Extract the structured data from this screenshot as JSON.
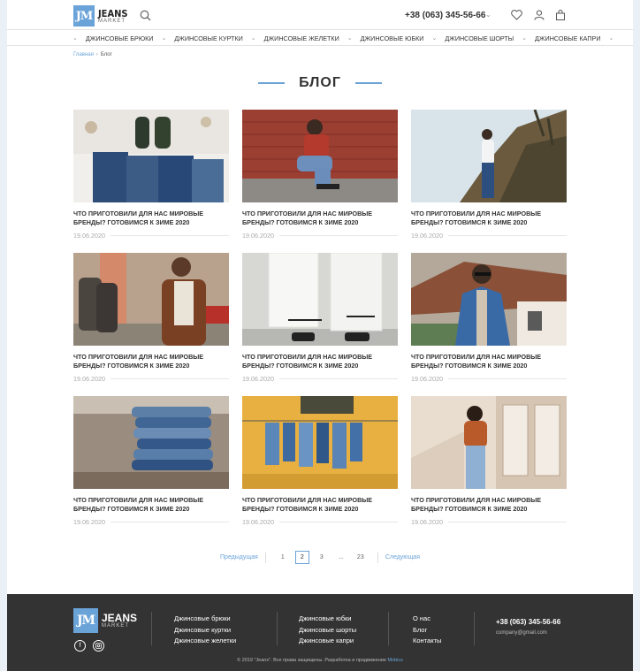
{
  "header": {
    "logo_mark": "JM",
    "logo_name": "JEANS",
    "logo_sub": "MARKET",
    "phone": "+38 (063) 345-56-66"
  },
  "nav": [
    "ДЖИНСОВЫЕ БРЮКИ",
    "ДЖИНСОВЫЕ КУРТКИ",
    "ДЖИНСОВЫЕ ЖЕЛЕТКИ",
    "ДЖИНСОВЫЕ ЮБКИ",
    "ДЖИНСОВЫЕ ШОРТЫ",
    "ДЖИНСОВЫЕ КАПРИ"
  ],
  "breadcrumb": {
    "home": "Главная",
    "current": "Блог"
  },
  "page_title": "БЛОГ",
  "posts": [
    {
      "title": "ЧТО ПРИГОТОВИЛИ ДЛЯ НАС МИРОВЫЕ БРЕНДЫ? ГОТОВИМСЯ К ЗИМЕ 2020",
      "date": "19.06.2020",
      "image": "folded-jeans-and-shoes"
    },
    {
      "title": "ЧТО ПРИГОТОВИЛИ ДЛЯ НАС МИРОВЫЕ БРЕНДЫ? ГОТОВИМСЯ К ЗИМЕ 2020",
      "date": "19.06.2020",
      "image": "woman-crouching-brick-wall"
    },
    {
      "title": "ЧТО ПРИГОТОВИЛИ ДЛЯ НАС МИРОВЫЕ БРЕНДЫ? ГОТОВИМСЯ К ЗИМЕ 2020",
      "date": "19.06.2020",
      "image": "woman-on-hill"
    },
    {
      "title": "ЧТО ПРИГОТОВИЛИ ДЛЯ НАС МИРОВЫЕ БРЕНДЫ? ГОТОВИМСЯ К ЗИМЕ 2020",
      "date": "19.06.2020",
      "image": "man-brown-jacket-street"
    },
    {
      "title": "ЧТО ПРИГОТОВИЛИ ДЛЯ НАС МИРОВЫЕ БРЕНДЫ? ГОТОВИМСЯ К ЗИМЕ 2020",
      "date": "19.06.2020",
      "image": "white-jeans-closeup"
    },
    {
      "title": "ЧТО ПРИГОТОВИЛИ ДЛЯ НАС МИРОВЫЕ БРЕНДЫ? ГОТОВИМСЯ К ЗИМЕ 2020",
      "date": "19.06.2020",
      "image": "man-denim-jacket-sunglasses"
    },
    {
      "title": "ЧТО ПРИГОТОВИЛИ ДЛЯ НАС МИРОВЫЕ БРЕНДЫ? ГОТОВИМСЯ К ЗИМЕ 2020",
      "date": "19.06.2020",
      "image": "stack-of-jeans"
    },
    {
      "title": "ЧТО ПРИГОТОВИЛИ ДЛЯ НАС МИРОВЫЕ БРЕНДЫ? ГОТОВИМСЯ К ЗИМЕ 2020",
      "date": "19.06.2020",
      "image": "jeans-hanging-line"
    },
    {
      "title": "ЧТО ПРИГОТОВИЛИ ДЛЯ НАС МИРОВЫЕ БРЕНДЫ? ГОТОВИМСЯ К ЗИМЕ 2020",
      "date": "19.06.2020",
      "image": "woman-orange-sweater"
    }
  ],
  "pagination": {
    "prev": "Предыдущая",
    "pages": [
      "1",
      "2",
      "3",
      "...",
      "23"
    ],
    "active": "2",
    "next": "Следующая"
  },
  "footer": {
    "logo_mark": "JM",
    "logo_name": "JEANS",
    "logo_sub": "MARKET",
    "col1": [
      "Джинсовые брюки",
      "Джинсовые куртки",
      "Джинсовые желетки"
    ],
    "col2": [
      "Джинсовые юбки",
      "Джинсовые шорты",
      "Джинсовые капри"
    ],
    "col3": [
      "О нас",
      "Блог",
      "Контакты"
    ],
    "phone": "+38 (063) 345-56-66",
    "email": "company@gmail.com",
    "copyright": "© 2019 \"Jeans\". Все права защищены. Разработка и продвижение",
    "copyright_link": "Mobics",
    "social": [
      "facebook-icon",
      "instagram-icon"
    ]
  },
  "colors": {
    "accent": "#6aa3d8",
    "footer_bg": "#333333"
  }
}
